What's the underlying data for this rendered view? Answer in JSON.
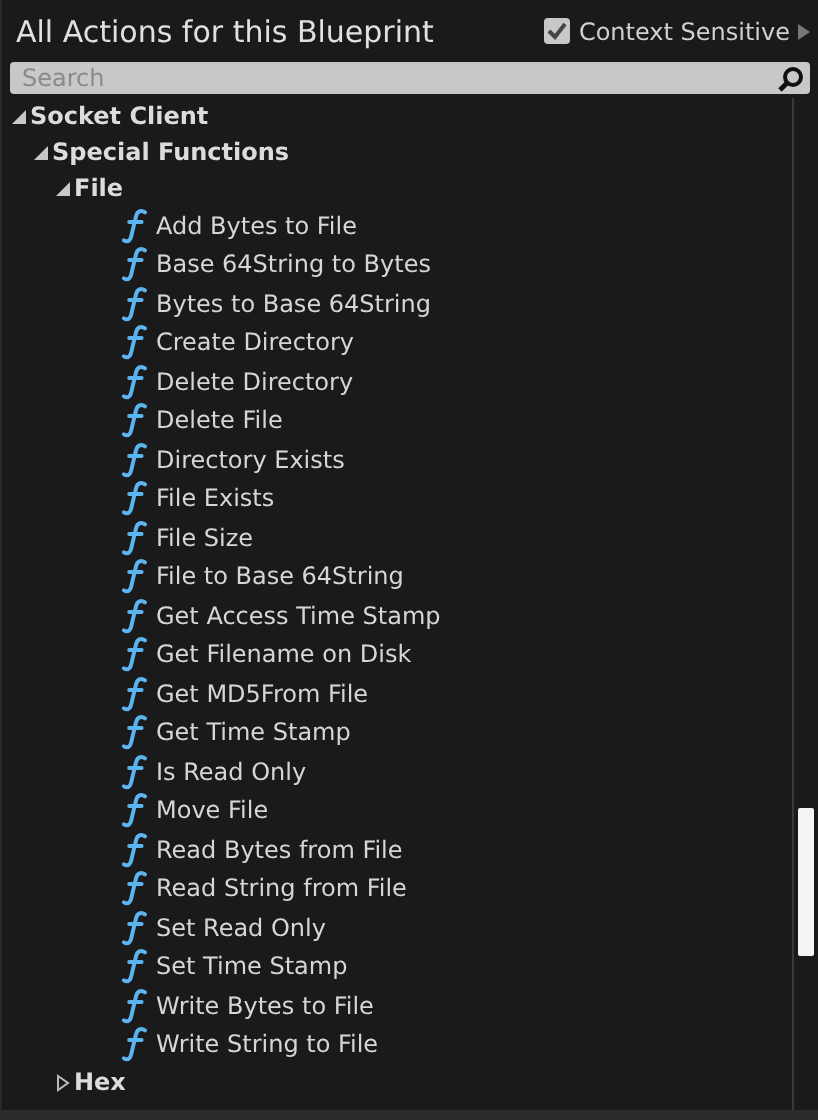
{
  "title": "All Actions for this Blueprint",
  "context_sensitive": {
    "label": "Context Sensitive",
    "checked": true
  },
  "search": {
    "placeholder": "Search"
  },
  "tree": [
    {
      "label": "Socket Client",
      "kind": "category",
      "expanded": true,
      "children": [
        {
          "label": "Special Functions",
          "kind": "category",
          "expanded": true,
          "children": [
            {
              "label": "File",
              "kind": "category",
              "expanded": true,
              "children": [
                {
                  "label": "Add Bytes to File",
                  "kind": "function"
                },
                {
                  "label": "Base 64String to Bytes",
                  "kind": "function"
                },
                {
                  "label": "Bytes to Base 64String",
                  "kind": "function"
                },
                {
                  "label": "Create Directory",
                  "kind": "function"
                },
                {
                  "label": "Delete Directory",
                  "kind": "function"
                },
                {
                  "label": "Delete File",
                  "kind": "function"
                },
                {
                  "label": "Directory Exists",
                  "kind": "function"
                },
                {
                  "label": "File Exists",
                  "kind": "function"
                },
                {
                  "label": "File Size",
                  "kind": "function"
                },
                {
                  "label": "File to Base 64String",
                  "kind": "function"
                },
                {
                  "label": "Get Access Time Stamp",
                  "kind": "function"
                },
                {
                  "label": "Get Filename on Disk",
                  "kind": "function"
                },
                {
                  "label": "Get MD5From File",
                  "kind": "function"
                },
                {
                  "label": "Get Time Stamp",
                  "kind": "function"
                },
                {
                  "label": "Is Read Only",
                  "kind": "function"
                },
                {
                  "label": "Move File",
                  "kind": "function"
                },
                {
                  "label": "Read Bytes from File",
                  "kind": "function"
                },
                {
                  "label": "Read String from File",
                  "kind": "function"
                },
                {
                  "label": "Set Read Only",
                  "kind": "function"
                },
                {
                  "label": "Set Time Stamp",
                  "kind": "function"
                },
                {
                  "label": "Write Bytes to File",
                  "kind": "function"
                },
                {
                  "label": "Write String to File",
                  "kind": "function"
                }
              ]
            },
            {
              "label": "Hex",
              "kind": "category",
              "expanded": false
            }
          ]
        }
      ]
    }
  ]
}
